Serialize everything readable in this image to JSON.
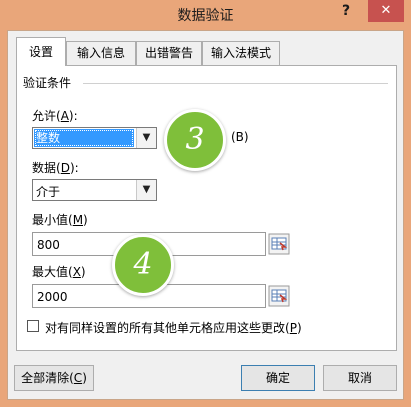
{
  "dialog": {
    "title": "数据验证"
  },
  "titlebar": {
    "help": "?",
    "close": "✕"
  },
  "tabs": [
    {
      "label": "设置",
      "active": true
    },
    {
      "label": "输入信息",
      "active": false
    },
    {
      "label": "出错警告",
      "active": false
    },
    {
      "label": "输入法模式",
      "active": false
    }
  ],
  "section": {
    "title": "验证条件"
  },
  "allow": {
    "label": "允许(",
    "key": "A",
    "tail": "):",
    "value": "整数"
  },
  "ignore_blank": {
    "hint": "(B)"
  },
  "data": {
    "label": "数据(",
    "key": "D",
    "tail": "):",
    "value": "介于"
  },
  "min": {
    "label": "最小值(",
    "key": "M",
    "tail": ")",
    "value": "800"
  },
  "max": {
    "label": "最大值(",
    "key": "X",
    "tail": ")",
    "value": "2000"
  },
  "apply_all": {
    "label": "对有同样设置的所有其他单元格应用这些更改(",
    "key": "P",
    "tail": ")",
    "checked": false
  },
  "buttons": {
    "clear": {
      "label": "全部清除(",
      "key": "C",
      "tail": ")"
    },
    "ok": "确定",
    "cancel": "取消"
  },
  "annotations": {
    "step3": "3",
    "step4": "4"
  },
  "colors": {
    "title_bar": "#e9a67a",
    "close_button": "#c7524f",
    "selection": "#3399ff",
    "step_bubble": "#7fbf3a"
  }
}
